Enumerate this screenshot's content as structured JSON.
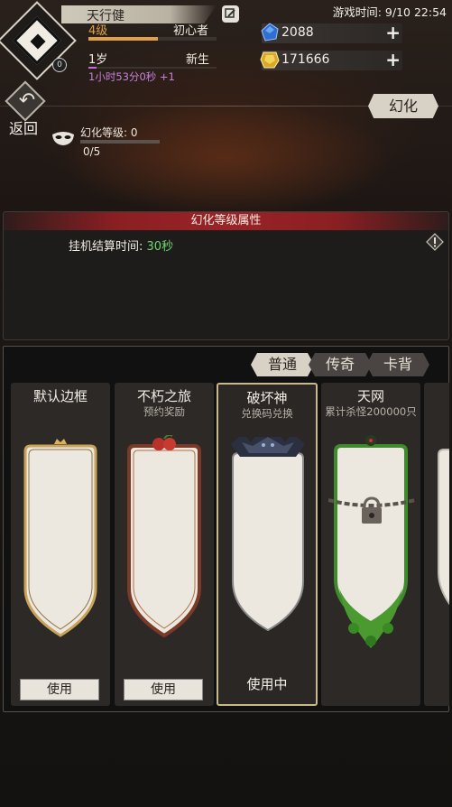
{
  "header": {
    "player_name": "天行健",
    "level": "4级",
    "rank": "初心者",
    "level_progress_pct": 54,
    "age": "1岁",
    "age_title": "新生",
    "age_progress_pct": 6,
    "timer": "1小时53分0秒 +1",
    "avatar_badge": "0",
    "game_time": "游戏时间: 9/10 22:54"
  },
  "resources": [
    {
      "name": "blue-gem",
      "value": "2088",
      "color": "#3a7fd6"
    },
    {
      "name": "gold-gem",
      "value": "171666",
      "color": "#e8b832"
    }
  ],
  "nav": {
    "back_label": "返回",
    "transform_label": "幻化"
  },
  "huanhua": {
    "level_label": "幻化等级: 0",
    "count_label": "0/5",
    "progress_pct": 0
  },
  "attributes": {
    "title": "幻化等级属性",
    "line_label": "挂机结算时间:",
    "line_value": "30秒"
  },
  "tabs": [
    {
      "label": "普通",
      "active": true
    },
    {
      "label": "传奇",
      "active": false
    },
    {
      "label": "卡背",
      "active": false
    }
  ],
  "cards": [
    {
      "title": "默认边框",
      "subtitle": "",
      "action": "使用",
      "state": "button"
    },
    {
      "title": "不朽之旅",
      "subtitle": "预约奖励",
      "action": "使用",
      "state": "button"
    },
    {
      "title": "破坏神",
      "subtitle": "兑换码兑换",
      "action": "使用中",
      "state": "in-use"
    },
    {
      "title": "天网",
      "subtitle": "累计杀怪200000只",
      "action": "",
      "state": "locked"
    }
  ],
  "colors": {
    "accent_red": "#8a1f22",
    "value_green": "#6fd66f",
    "timer_purple": "#c882d8",
    "level_orange": "#e0a04a"
  }
}
